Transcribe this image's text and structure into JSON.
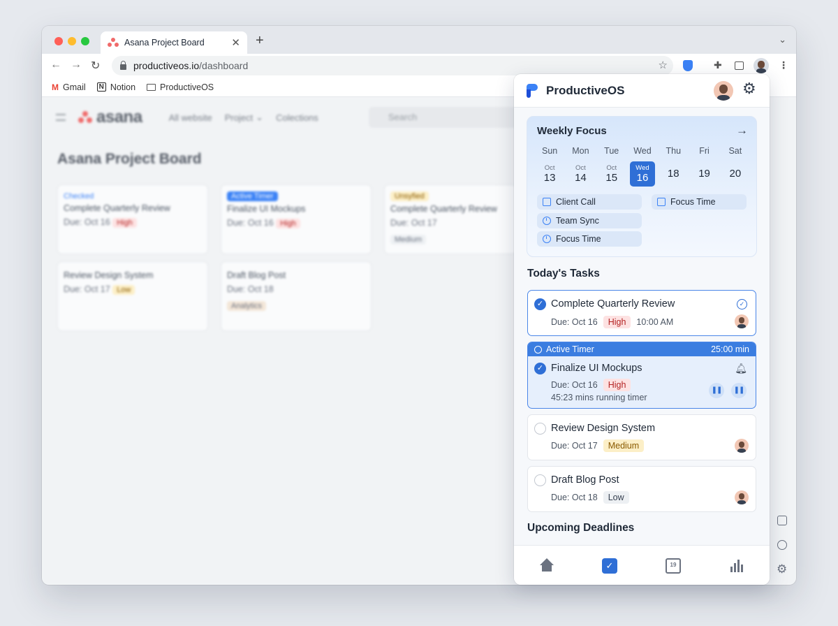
{
  "browser": {
    "tab_title": "Asana Project Board",
    "url_host": "productiveos.io",
    "url_path": "/dashboard",
    "bookmarks": [
      "Gmail",
      "Notion",
      "ProductiveOS"
    ]
  },
  "background_page": {
    "app_name": "asana",
    "nav": [
      "All website",
      "Project",
      "Colections"
    ],
    "search_placeholder": "Search",
    "board_title": "Asana Project Board",
    "cards": [
      {
        "tag": "Checked",
        "title": "Complete Quarterly Review",
        "due": "Due: Oct 16",
        "priority": "High"
      },
      {
        "tag": "Active Timer",
        "title": "Finalize UI Mockups",
        "due": "Due: Oct 16",
        "priority": "High"
      },
      {
        "tag": "Unsyfied",
        "title": "Complete Quarterly Review",
        "due": "Due: Oct 17",
        "priority": "Medium"
      },
      {
        "tag": "",
        "title": "Review Design System",
        "due": "Due: Oct 17",
        "priority": "Low"
      },
      {
        "tag": "",
        "title": "Draft Blog Post",
        "due": "Due: Oct 18",
        "priority": "Analytics"
      }
    ]
  },
  "extension": {
    "name": "ProductiveOS",
    "weekly_focus": {
      "title": "Weekly Focus",
      "days": [
        {
          "name": "Sun",
          "month": "Oct",
          "num": "13",
          "today": false
        },
        {
          "name": "Mon",
          "month": "Oct",
          "num": "14",
          "today": false
        },
        {
          "name": "Tue",
          "month": "Oct",
          "num": "15",
          "today": false
        },
        {
          "name": "Wed",
          "month": "Wed",
          "num": "16",
          "today": true
        },
        {
          "name": "Thu",
          "month": "",
          "num": "18",
          "today": false
        },
        {
          "name": "Fri",
          "month": "",
          "num": "19",
          "today": false
        },
        {
          "name": "Sat",
          "month": "",
          "num": "20",
          "today": false
        }
      ],
      "events": [
        "Client Call",
        "Focus Time",
        "Team Sync",
        "Focus Time"
      ]
    },
    "todays_tasks_title": "Today's Tasks",
    "tasks": [
      {
        "title": "Complete Quarterly Review",
        "due": "Due: Oct 16",
        "priority": "High",
        "time": "10:00 AM"
      },
      {
        "timer_label": "Active Timer",
        "timer_duration": "25:00 min",
        "title": "Finalize UI Mockups",
        "due": "Due: Oct 16",
        "priority": "High",
        "running": "45:23 mins running timer"
      },
      {
        "title": "Review Design System",
        "due": "Due: Oct 17",
        "priority": "Medium"
      },
      {
        "title": "Draft Blog Post",
        "due": "Due: Oct 18",
        "priority": "Low"
      }
    ],
    "upcoming_title": "Upcoming Deadlines",
    "calendar_icon_text": "19"
  }
}
